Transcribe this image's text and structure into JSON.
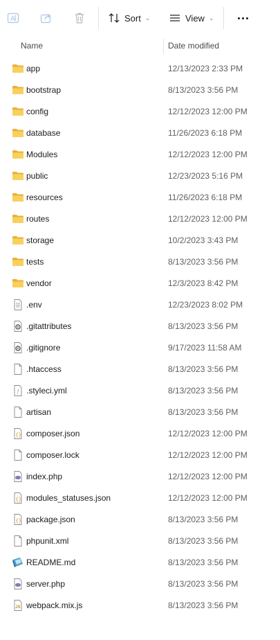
{
  "toolbar": {
    "sort_label": "Sort",
    "view_label": "View",
    "icons": [
      "rename-icon",
      "share-icon",
      "delete-icon",
      "sort-icon",
      "view-icon",
      "more-icon"
    ]
  },
  "columns": {
    "name": "Name",
    "date_modified": "Date modified"
  },
  "colors": {
    "folder": "#f4c542",
    "accent": "#0067c0"
  },
  "files": [
    {
      "name": "app",
      "date": "12/13/2023 2:33 PM",
      "icon": "folder-icon"
    },
    {
      "name": "bootstrap",
      "date": "8/13/2023 3:56 PM",
      "icon": "folder-icon"
    },
    {
      "name": "config",
      "date": "12/12/2023 12:00 PM",
      "icon": "folder-icon"
    },
    {
      "name": "database",
      "date": "11/26/2023 6:18 PM",
      "icon": "folder-icon"
    },
    {
      "name": "Modules",
      "date": "12/12/2023 12:00 PM",
      "icon": "folder-icon"
    },
    {
      "name": "public",
      "date": "12/23/2023 5:16 PM",
      "icon": "folder-icon"
    },
    {
      "name": "resources",
      "date": "11/26/2023 6:18 PM",
      "icon": "folder-icon"
    },
    {
      "name": "routes",
      "date": "12/12/2023 12:00 PM",
      "icon": "folder-icon"
    },
    {
      "name": "storage",
      "date": "10/2/2023 3:43 PM",
      "icon": "folder-icon"
    },
    {
      "name": "tests",
      "date": "8/13/2023 3:56 PM",
      "icon": "folder-icon"
    },
    {
      "name": "vendor",
      "date": "12/3/2023 8:42 PM",
      "icon": "folder-icon"
    },
    {
      "name": ".env",
      "date": "12/23/2023 8:02 PM",
      "icon": "text-file-icon"
    },
    {
      "name": ".gitattributes",
      "date": "8/13/2023 3:56 PM",
      "icon": "config-file-icon"
    },
    {
      "name": ".gitignore",
      "date": "9/17/2023 11:58 AM",
      "icon": "config-file-icon"
    },
    {
      "name": ".htaccess",
      "date": "8/13/2023 3:56 PM",
      "icon": "blank-file-icon"
    },
    {
      "name": ".styleci.yml",
      "date": "8/13/2023 3:56 PM",
      "icon": "yml-file-icon"
    },
    {
      "name": "artisan",
      "date": "8/13/2023 3:56 PM",
      "icon": "blank-file-icon"
    },
    {
      "name": "composer.json",
      "date": "12/12/2023 12:00 PM",
      "icon": "json-file-icon"
    },
    {
      "name": "composer.lock",
      "date": "12/12/2023 12:00 PM",
      "icon": "blank-file-icon"
    },
    {
      "name": "index.php",
      "date": "12/12/2023 12:00 PM",
      "icon": "php-file-icon"
    },
    {
      "name": "modules_statuses.json",
      "date": "12/12/2023 12:00 PM",
      "icon": "json-file-icon"
    },
    {
      "name": "package.json",
      "date": "8/13/2023 3:56 PM",
      "icon": "json-file-icon"
    },
    {
      "name": "phpunit.xml",
      "date": "8/13/2023 3:56 PM",
      "icon": "blank-file-icon"
    },
    {
      "name": "README.md",
      "date": "8/13/2023 3:56 PM",
      "icon": "markdown-file-icon"
    },
    {
      "name": "server.php",
      "date": "8/13/2023 3:56 PM",
      "icon": "php-file-icon"
    },
    {
      "name": "webpack.mix.js",
      "date": "8/13/2023 3:56 PM",
      "icon": "js-file-icon"
    }
  ]
}
